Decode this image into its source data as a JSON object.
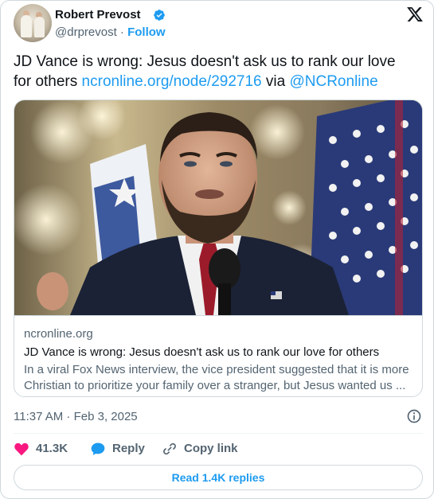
{
  "author": {
    "name": "Robert Prevost",
    "handle": "@drprevost",
    "separator": " · ",
    "follow_label": "Follow"
  },
  "tweet": {
    "text_before": "JD Vance is wrong: Jesus doesn't ask us to rank our love for others ",
    "link": "ncronline.org/node/292716",
    "via": " via ",
    "mention": "@NCRonline"
  },
  "link_card": {
    "domain": "ncronline.org",
    "title": "JD Vance is wrong: Jesus doesn't ask us to rank our love for others",
    "description": "In a viral Fox News interview, the vice president suggested that it is more Christian to prioritize your family over a stranger, but Jesus wanted us ..."
  },
  "meta": {
    "timestamp": "11:37 AM · Feb 3, 2025"
  },
  "actions": {
    "likes": "41.3K",
    "reply_label": "Reply",
    "copy_label": "Copy link"
  },
  "read_replies_label": "Read 1.4K replies",
  "colors": {
    "accent": "#1d9bf0",
    "like": "#f91880",
    "text": "#0f1419",
    "muted": "#536471",
    "border": "#cfd9de"
  },
  "icons": [
    "verified-badge-icon",
    "x-logo-icon",
    "info-icon",
    "heart-icon",
    "reply-bubble-icon",
    "link-icon"
  ]
}
